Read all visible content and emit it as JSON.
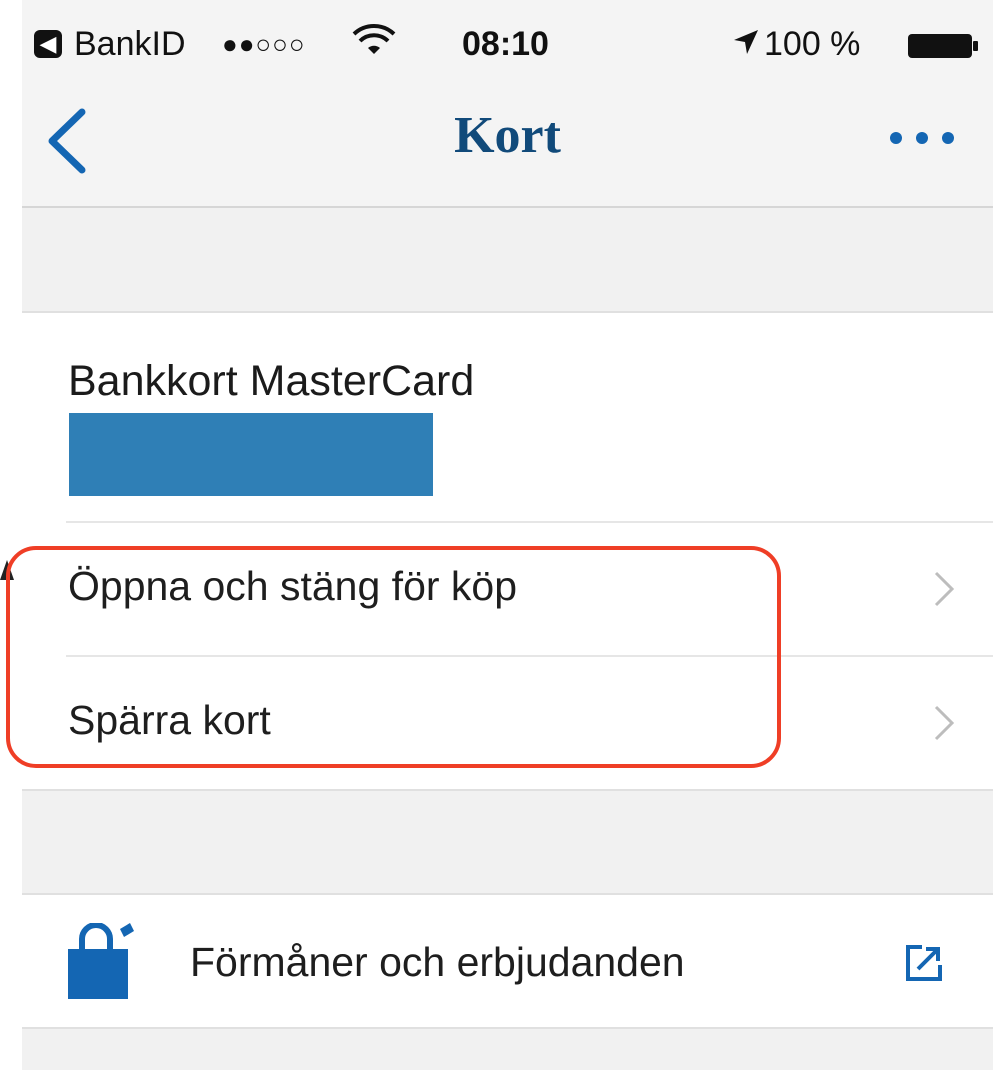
{
  "status_bar": {
    "back_app": "BankID",
    "signal_dots": "●●○○○",
    "time": "08:10",
    "battery": "100 %"
  },
  "nav": {
    "title": "Kort"
  },
  "card": {
    "title": "Bankkort MasterCard",
    "rows": [
      {
        "label": "Öppna och stäng för köp"
      },
      {
        "label": "Spärra kort"
      }
    ]
  },
  "offers": {
    "label": "Förmåner och erbjudanden"
  },
  "colors": {
    "accent": "#1466b3",
    "title": "#114a7a",
    "highlight": "#ef3e26",
    "redaction": "#2f7fb6"
  }
}
